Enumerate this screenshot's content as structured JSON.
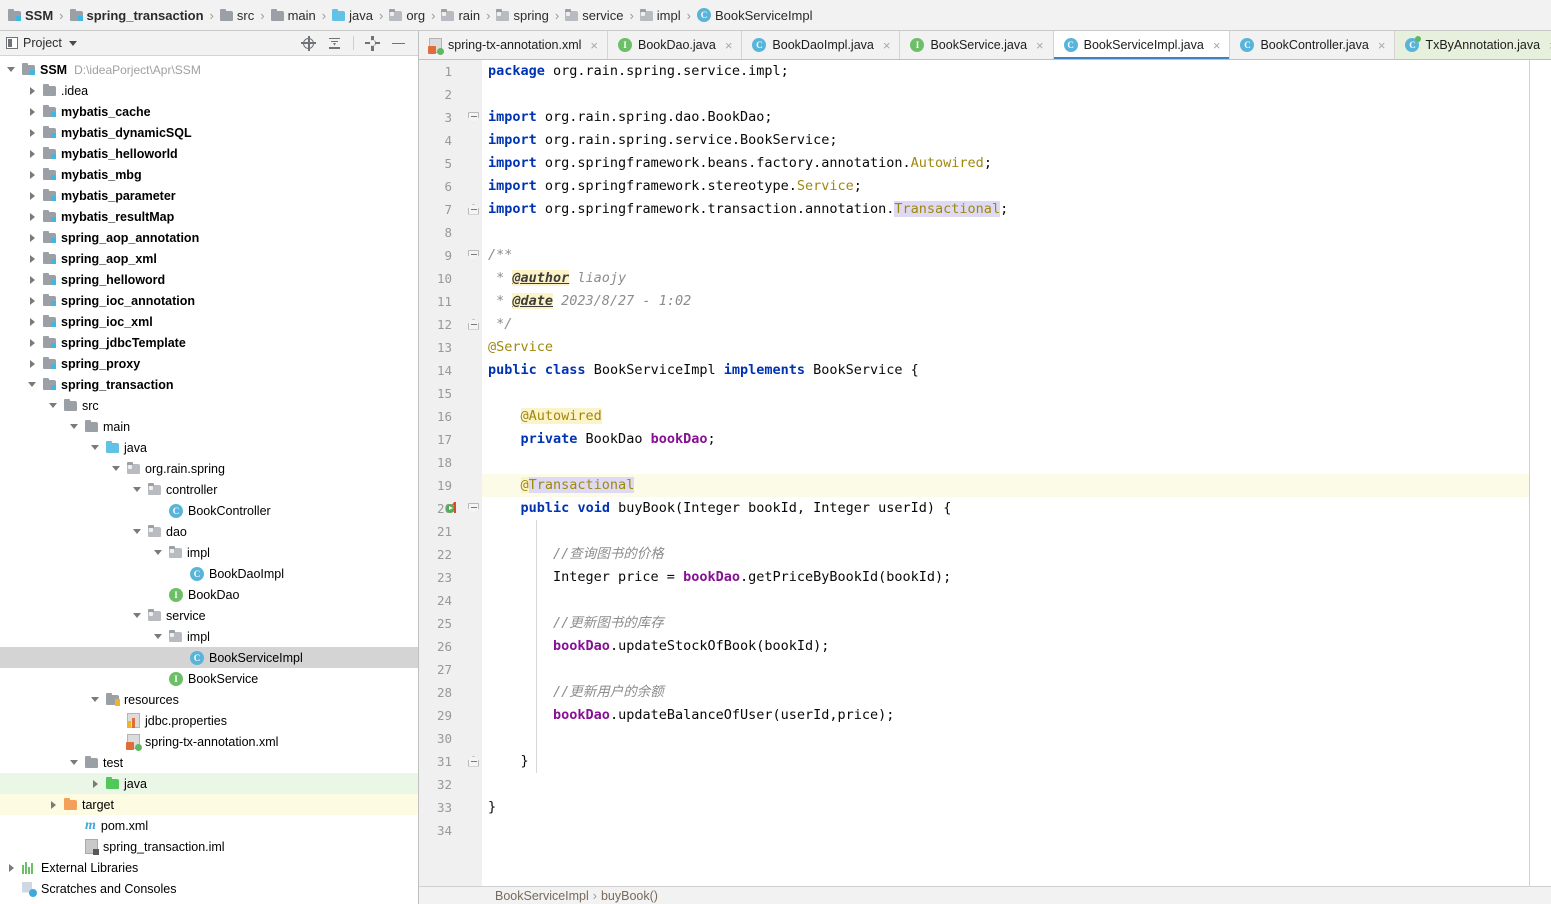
{
  "navbar": {
    "items": [
      {
        "label": "SSM",
        "icon": "module-icon",
        "bold": true,
        "path": "D:\\ideaPorject\\Apr\\SSM"
      },
      {
        "label": "spring_transaction",
        "icon": "module-icon",
        "bold": true
      },
      {
        "label": "src",
        "icon": "folder-icon",
        "bold": false
      },
      {
        "label": "main",
        "icon": "folder-icon",
        "bold": false
      },
      {
        "label": "java",
        "icon": "source-folder-icon",
        "bold": false
      },
      {
        "label": "org",
        "icon": "package-icon",
        "bold": false
      },
      {
        "label": "rain",
        "icon": "package-icon",
        "bold": false
      },
      {
        "label": "spring",
        "icon": "package-icon",
        "bold": false
      },
      {
        "label": "service",
        "icon": "package-icon",
        "bold": false
      },
      {
        "label": "impl",
        "icon": "package-icon",
        "bold": false
      },
      {
        "label": "BookServiceImpl",
        "icon": "class-icon",
        "bold": false
      }
    ],
    "separator": "›"
  },
  "project_panel": {
    "title": "Project",
    "tools": [
      "locate-icon",
      "collapse-all-icon",
      "settings-gear-icon",
      "minimize-icon"
    ],
    "tree": [
      {
        "label": "SSM",
        "path": "D:\\ideaPorject\\Apr\\SSM",
        "depth": 0,
        "arrow": "down",
        "icon": "module-icon",
        "bold": true
      },
      {
        "label": ".idea",
        "depth": 1,
        "arrow": "right",
        "icon": "folder-icon",
        "bold": false
      },
      {
        "label": "mybatis_cache",
        "depth": 1,
        "arrow": "right",
        "icon": "module-icon",
        "bold": true
      },
      {
        "label": "mybatis_dynamicSQL",
        "depth": 1,
        "arrow": "right",
        "icon": "module-icon",
        "bold": true
      },
      {
        "label": "mybatis_helloworld",
        "depth": 1,
        "arrow": "right",
        "icon": "module-icon",
        "bold": true
      },
      {
        "label": "mybatis_mbg",
        "depth": 1,
        "arrow": "right",
        "icon": "module-icon",
        "bold": true
      },
      {
        "label": "mybatis_parameter",
        "depth": 1,
        "arrow": "right",
        "icon": "module-icon",
        "bold": true
      },
      {
        "label": "mybatis_resultMap",
        "depth": 1,
        "arrow": "right",
        "icon": "module-icon",
        "bold": true
      },
      {
        "label": "spring_aop_annotation",
        "depth": 1,
        "arrow": "right",
        "icon": "module-icon",
        "bold": true
      },
      {
        "label": "spring_aop_xml",
        "depth": 1,
        "arrow": "right",
        "icon": "module-icon",
        "bold": true
      },
      {
        "label": "spring_helloword",
        "depth": 1,
        "arrow": "right",
        "icon": "module-icon",
        "bold": true
      },
      {
        "label": "spring_ioc_annotation",
        "depth": 1,
        "arrow": "right",
        "icon": "module-icon",
        "bold": true
      },
      {
        "label": "spring_ioc_xml",
        "depth": 1,
        "arrow": "right",
        "icon": "module-icon",
        "bold": true
      },
      {
        "label": "spring_jdbcTemplate",
        "depth": 1,
        "arrow": "right",
        "icon": "module-icon",
        "bold": true
      },
      {
        "label": "spring_proxy",
        "depth": 1,
        "arrow": "right",
        "icon": "module-icon",
        "bold": true
      },
      {
        "label": "spring_transaction",
        "depth": 1,
        "arrow": "down",
        "icon": "module-icon",
        "bold": true
      },
      {
        "label": "src",
        "depth": 2,
        "arrow": "down",
        "icon": "folder-icon",
        "bold": false
      },
      {
        "label": "main",
        "depth": 3,
        "arrow": "down",
        "icon": "folder-icon",
        "bold": false
      },
      {
        "label": "java",
        "depth": 4,
        "arrow": "down",
        "icon": "source-folder-icon",
        "bold": false
      },
      {
        "label": "org.rain.spring",
        "depth": 5,
        "arrow": "down",
        "icon": "package-icon",
        "bold": false
      },
      {
        "label": "controller",
        "depth": 6,
        "arrow": "down",
        "icon": "package-icon",
        "bold": false
      },
      {
        "label": "BookController",
        "depth": 7,
        "arrow": "none",
        "icon": "class-icon",
        "bold": false
      },
      {
        "label": "dao",
        "depth": 6,
        "arrow": "down",
        "icon": "package-icon",
        "bold": false
      },
      {
        "label": "impl",
        "depth": 7,
        "arrow": "down",
        "icon": "package-icon",
        "bold": false
      },
      {
        "label": "BookDaoImpl",
        "depth": 8,
        "arrow": "none",
        "icon": "class-icon",
        "bold": false
      },
      {
        "label": "BookDao",
        "depth": 7,
        "arrow": "none",
        "icon": "interface-icon",
        "bold": false
      },
      {
        "label": "service",
        "depth": 6,
        "arrow": "down",
        "icon": "package-icon",
        "bold": false
      },
      {
        "label": "impl",
        "depth": 7,
        "arrow": "down",
        "icon": "package-icon",
        "bold": false
      },
      {
        "label": "BookServiceImpl",
        "depth": 8,
        "arrow": "none",
        "icon": "class-icon",
        "bold": false,
        "state": "selected"
      },
      {
        "label": "BookService",
        "depth": 7,
        "arrow": "none",
        "icon": "interface-icon",
        "bold": false
      },
      {
        "label": "resources",
        "depth": 4,
        "arrow": "down",
        "icon": "resources-folder-icon",
        "bold": false
      },
      {
        "label": "jdbc.properties",
        "depth": 5,
        "arrow": "none",
        "icon": "properties-file-icon",
        "bold": false
      },
      {
        "label": "spring-tx-annotation.xml",
        "depth": 5,
        "arrow": "none",
        "icon": "xml-file-icon",
        "bold": false
      },
      {
        "label": "test",
        "depth": 3,
        "arrow": "down",
        "icon": "folder-icon",
        "bold": false
      },
      {
        "label": "java",
        "depth": 4,
        "arrow": "right",
        "icon": "test-source-folder-icon",
        "bold": false,
        "state": "green"
      },
      {
        "label": "target",
        "depth": 2,
        "arrow": "right",
        "icon": "excluded-folder-icon",
        "bold": false,
        "state": "yellow"
      },
      {
        "label": "pom.xml",
        "depth": 3,
        "arrow": "none",
        "icon": "maven-icon",
        "bold": false
      },
      {
        "label": "spring_transaction.iml",
        "depth": 3,
        "arrow": "none",
        "icon": "iml-file-icon",
        "bold": false
      },
      {
        "label": "External Libraries",
        "depth": 0,
        "arrow": "right",
        "icon": "libraries-icon",
        "bold": false
      },
      {
        "label": "Scratches and Consoles",
        "depth": 0,
        "arrow": "none",
        "icon": "scratches-icon",
        "bold": false
      }
    ]
  },
  "editor_tabs": [
    {
      "label": "spring-tx-annotation.xml",
      "icon": "xml-file-icon",
      "active": false,
      "close": "×"
    },
    {
      "label": "BookDao.java",
      "icon": "interface-icon",
      "active": false,
      "close": "×"
    },
    {
      "label": "BookDaoImpl.java",
      "icon": "class-icon",
      "active": false,
      "close": "×"
    },
    {
      "label": "BookService.java",
      "icon": "interface-icon",
      "active": false,
      "close": "×"
    },
    {
      "label": "BookServiceImpl.java",
      "icon": "class-icon",
      "active": true,
      "close": "×"
    },
    {
      "label": "BookController.java",
      "icon": "class-icon",
      "active": false,
      "close": "×"
    },
    {
      "label": "TxByAnnotation.java",
      "icon": "test-class-icon",
      "active": false,
      "close": "×",
      "highlight": "green"
    }
  ],
  "code": {
    "file": "BookServiceImpl.java",
    "current_line": 19,
    "total_lines": 34,
    "lines": [
      {
        "n": 1,
        "text": "package org.rain.spring.service.impl;"
      },
      {
        "n": 2,
        "text": ""
      },
      {
        "n": 3,
        "text": "import org.rain.spring.dao.BookDao;"
      },
      {
        "n": 4,
        "text": "import org.rain.spring.service.BookService;"
      },
      {
        "n": 5,
        "text": "import org.springframework.beans.factory.annotation.Autowired;"
      },
      {
        "n": 6,
        "text": "import org.springframework.stereotype.Service;"
      },
      {
        "n": 7,
        "text": "import org.springframework.transaction.annotation.Transactional;"
      },
      {
        "n": 8,
        "text": ""
      },
      {
        "n": 9,
        "text": "/**"
      },
      {
        "n": 10,
        "text": " * @author liaojy"
      },
      {
        "n": 11,
        "text": " * @date 2023/8/27 - 1:02"
      },
      {
        "n": 12,
        "text": " */"
      },
      {
        "n": 13,
        "text": "@Service"
      },
      {
        "n": 14,
        "text": "public class BookServiceImpl implements BookService {"
      },
      {
        "n": 15,
        "text": ""
      },
      {
        "n": 16,
        "text": "    @Autowired"
      },
      {
        "n": 17,
        "text": "    private BookDao bookDao;"
      },
      {
        "n": 18,
        "text": ""
      },
      {
        "n": 19,
        "text": "    @Transactional"
      },
      {
        "n": 20,
        "text": "    public void buyBook(Integer bookId, Integer userId) {"
      },
      {
        "n": 21,
        "text": ""
      },
      {
        "n": 22,
        "text": "        //查询图书的价格"
      },
      {
        "n": 23,
        "text": "        Integer price = bookDao.getPriceByBookId(bookId);"
      },
      {
        "n": 24,
        "text": ""
      },
      {
        "n": 25,
        "text": "        //更新图书的库存"
      },
      {
        "n": 26,
        "text": "        bookDao.updateStockOfBook(bookId);"
      },
      {
        "n": 27,
        "text": ""
      },
      {
        "n": 28,
        "text": "        //更新用户的余额"
      },
      {
        "n": 29,
        "text": "        bookDao.updateBalanceOfUser(userId,price);"
      },
      {
        "n": 30,
        "text": ""
      },
      {
        "n": 31,
        "text": "    }"
      },
      {
        "n": 32,
        "text": ""
      },
      {
        "n": 33,
        "text": "}"
      },
      {
        "n": 34,
        "text": ""
      }
    ]
  },
  "status_breadcrumb": {
    "items": [
      "BookServiceImpl",
      "buyBook()"
    ],
    "separator": "›"
  },
  "colors": {
    "accent": "#3d82c4",
    "keyword": "#0033b3",
    "annotation": "#9e880d",
    "field": "#871094",
    "comment": "#8c8c8c",
    "selection": "#d4d4d4",
    "current_line": "#fcfbe7",
    "identifier_highlight": "#dfdaf3",
    "annotation_highlight": "#fdf3c8",
    "test_tab_bg": "#e6f0dc",
    "green_row": "#eaf7e7",
    "yellow_row": "#fdfce3"
  }
}
